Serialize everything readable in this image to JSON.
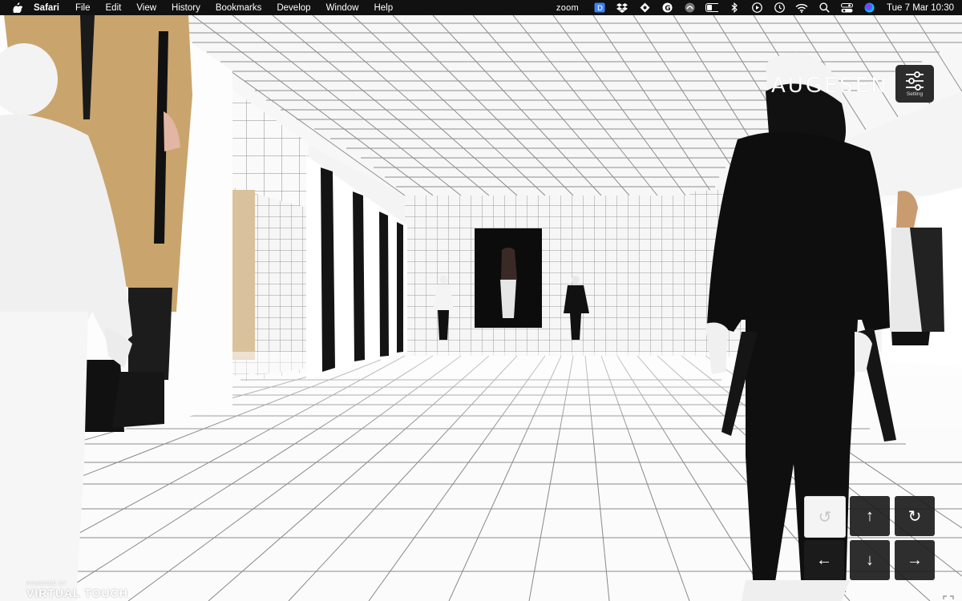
{
  "menubar": {
    "app_name": "Safari",
    "menus": [
      "File",
      "Edit",
      "View",
      "History",
      "Bookmarks",
      "Develop",
      "Window",
      "Help"
    ],
    "status_app": "zoom",
    "datetime": "Tue 7 Mar  10:30",
    "status_icons": [
      "zoom-app-icon",
      "dictionary-icon",
      "dropbox-icon",
      "ext-icon",
      "grammarly-icon",
      "vpn-icon",
      "battery-icon",
      "bluetooth-icon",
      "play-icon",
      "time-machine-icon",
      "wifi-icon",
      "search-icon",
      "control-center-icon",
      "siri-icon"
    ]
  },
  "scene": {
    "brand": "AUGESEN",
    "setting_label": "Setting",
    "credit_powered": "POWERED BY",
    "credit_vendor": "VIRTUAL TOUCH",
    "nav": {
      "rotate_left": "↺",
      "up": "↑",
      "rotate_right": "↻",
      "left": "←",
      "down": "↓",
      "right": "→"
    }
  },
  "colors": {
    "menubar_bg": "#111111",
    "button_dark": "#1c1c1c",
    "tile_line": "#8a8a8a"
  }
}
